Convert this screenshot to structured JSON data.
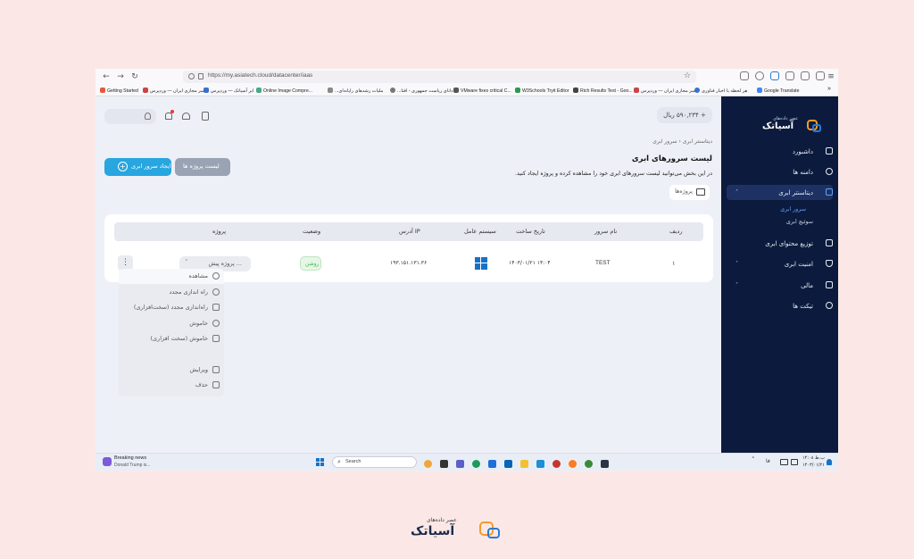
{
  "browser": {
    "url": "https://my.asiatech.cloud/datacenter/iaas",
    "bookmarks": [
      "Getting Started",
      "سر مجازی ایران — وردپرس",
      "ابر آسیاتک — وردپرس",
      "Online Image Compre...",
      "...ملیات رشدهای رایانه‌ای",
      "...دانای ریاست جمهوری - افتا",
      "VMware fixes critical C...",
      "W3Schools Tryit Editor",
      "Rich Results Test - Goo...",
      "سر مجازی ایران — وردپرس",
      "هر لحظه با اخبار فناوری",
      "Google Translate"
    ]
  },
  "topbar": {
    "balance": "۵۹۰,۲۳۴ ریال",
    "balance_plus": "+"
  },
  "breadcrumb": {
    "root": "دیتاسنتر ابری",
    "current": "سرور ابری",
    "sep": "‹"
  },
  "page": {
    "title": "لیست سرورهای ابری",
    "description": "در این بخش می‌توانید لیست سرورهای ابری خود را مشاهده کرده و پروژه ایجاد کنید.",
    "projects_filter": "پروژه‌ها",
    "btn_create": "ایجاد سرور ابری",
    "btn_projects": "لیست پروژه ها"
  },
  "table": {
    "headers": {
      "row": "ردیف",
      "name": "نام سرور",
      "created": "تاریخ ساخت",
      "os": "سیستم عامل",
      "ip": "آدرس IP",
      "status": "وضعیت",
      "project": "پروژه"
    },
    "rows": [
      {
        "row": "۱",
        "name": "TEST",
        "created": "۱۴۰۳/۰۱/۲۱ ۱۴:۰۴",
        "os": "windows-icon",
        "ip": "۱۹۳.۱۵۱.۱۳۱.۳۶",
        "status": "روشن",
        "project": "پروژه پیش ..."
      }
    ]
  },
  "menu": {
    "items": [
      {
        "label": "مشاهده",
        "icon": "eye-icon"
      },
      {
        "label": "راه اندازی مجدد",
        "icon": "restart-icon"
      },
      {
        "label": "راه‌اندازی مجدد (سخت‌افزاری)",
        "icon": "hard-restart-icon"
      },
      {
        "label": "خاموش",
        "icon": "power-icon"
      },
      {
        "label": "خاموش (سخت افزاری)",
        "icon": "hard-power-icon"
      },
      {
        "label": "ویرایش",
        "icon": "edit-icon"
      },
      {
        "label": "حذف",
        "icon": "trash-icon"
      }
    ]
  },
  "sidebar": {
    "brand_small": "عصر داده‌های",
    "brand": "آسیاتک",
    "items": [
      {
        "label": "داشبورد",
        "icon": "home-icon"
      },
      {
        "label": "دامنه ها",
        "icon": "globe-icon"
      },
      {
        "label": "دیتاسنتر ابری",
        "icon": "server-icon"
      },
      {
        "label": "سرور ابری"
      },
      {
        "label": "سوئیچ ابری"
      },
      {
        "label": "توزیع محتوای ابری",
        "icon": "cdn-icon"
      },
      {
        "label": "امنیت ابری",
        "icon": "shield-icon"
      },
      {
        "label": "مالی",
        "icon": "wallet-icon"
      },
      {
        "label": "تیکت ها",
        "icon": "chat-icon"
      }
    ]
  },
  "taskbar": {
    "news_title": "Breaking news",
    "news_sub": "Donald Trump is...",
    "search": "Search",
    "lang": "فا",
    "clock_time": "۱۴:۰۸ ب.ظ",
    "clock_date": "۱۴۰۳/۰۱/۲۱"
  },
  "footer_logo": {
    "small": "عصر داده‌های",
    "brand": "آسیاتک"
  },
  "colors": {
    "background": "#fbe8e6",
    "sidebar": "#0c1b3d",
    "primary_button": "#27a6e0",
    "secondary_button": "#9aa3b3",
    "status_on": "#3bb54a",
    "logo_orange": "#f39a2a",
    "logo_blue": "#2a7ad1"
  }
}
